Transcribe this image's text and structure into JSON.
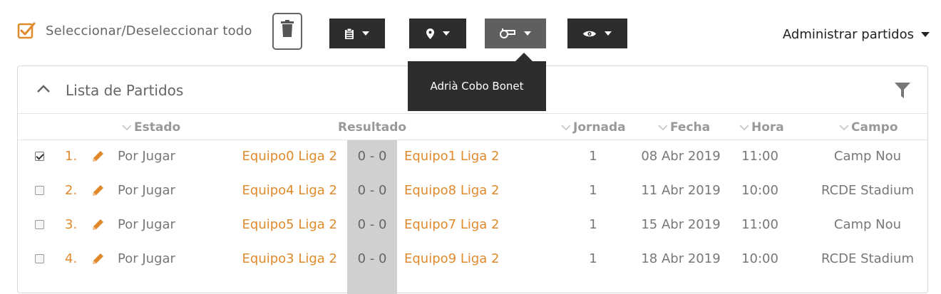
{
  "toolbar": {
    "select_all_label": "Seleccionar/Deseleccionar todo",
    "manage_label": "Administrar partidos",
    "dropdowns": [
      {
        "icon": "clipboard-icon"
      },
      {
        "icon": "map-pin-icon"
      },
      {
        "icon": "whistle-icon",
        "active": true
      },
      {
        "icon": "eye-icon"
      }
    ]
  },
  "tooltip": {
    "text": "Adrià Cobo Bonet"
  },
  "panel": {
    "title": "Lista de Partidos",
    "columns": {
      "estado": "Estado",
      "resultado": "Resultado",
      "jornada": "Jornada",
      "fecha": "Fecha",
      "hora": "Hora",
      "campo": "Campo"
    }
  },
  "matches": [
    {
      "checked": true,
      "num": "1.",
      "status": "Por Jugar",
      "home": "Equipo0 Liga 2",
      "score": "0 - 0",
      "away": "Equipo1 Liga 2",
      "round": "1",
      "date": "08 Abr 2019",
      "time": "11:00",
      "field": "Camp Nou"
    },
    {
      "checked": false,
      "num": "2.",
      "status": "Por Jugar",
      "home": "Equipo4 Liga 2",
      "score": "0 - 0",
      "away": "Equipo8 Liga 2",
      "round": "1",
      "date": "11 Abr 2019",
      "time": "10:00",
      "field": "RCDE Stadium"
    },
    {
      "checked": false,
      "num": "3.",
      "status": "Por Jugar",
      "home": "Equipo5 Liga 2",
      "score": "0 - 0",
      "away": "Equipo7 Liga 2",
      "round": "1",
      "date": "15 Abr 2019",
      "time": "11:00",
      "field": "Camp Nou"
    },
    {
      "checked": false,
      "num": "4.",
      "status": "Por Jugar",
      "home": "Equipo3 Liga 2",
      "score": "0 - 0",
      "away": "Equipo9 Liga 2",
      "round": "1",
      "date": "18 Abr 2019",
      "time": "10:00",
      "field": "RCDE Stadium"
    }
  ],
  "colors": {
    "accent": "#e08a2c",
    "dark_button": "#2d2d2d",
    "active_button": "#5f5f5f",
    "score_bg": "#d0d0d0"
  }
}
